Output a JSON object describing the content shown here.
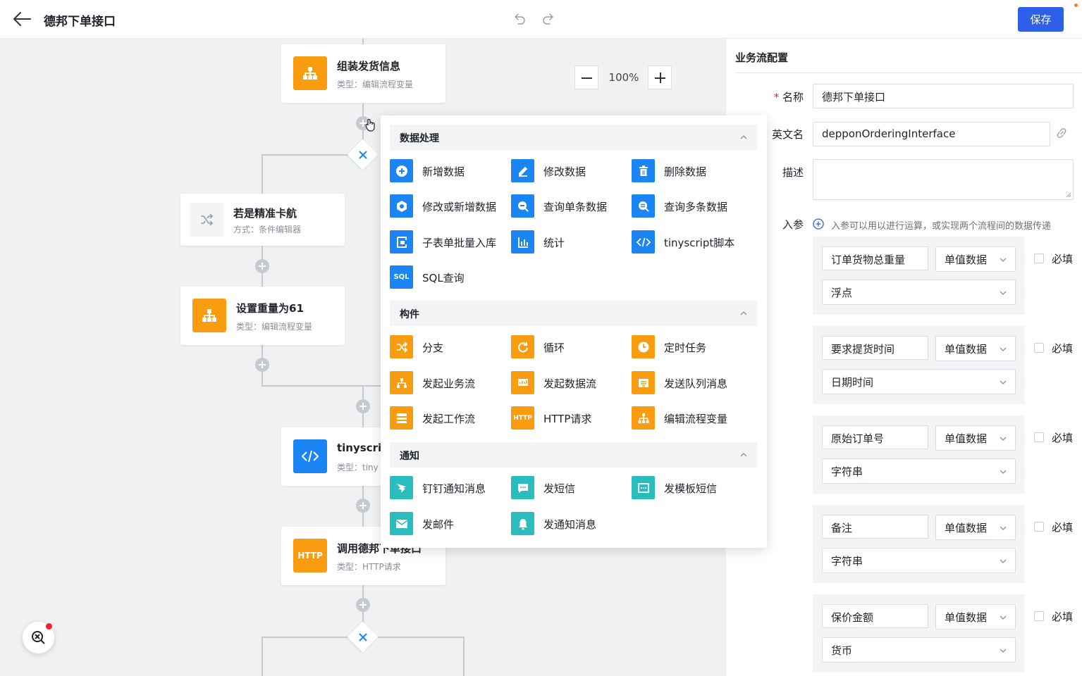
{
  "header": {
    "title": "德邦下单接口",
    "save_label": "保存"
  },
  "canvas": {
    "zoom": "100%",
    "nodes": [
      {
        "title": "组装发货信息",
        "subtitle": "类型：编辑流程变量"
      },
      {
        "title": "若是精准卡航",
        "subtitle": "方式：条件编辑器"
      },
      {
        "title": "设置重量为61",
        "subtitle": "类型：编辑流程变量"
      },
      {
        "title": "tinyscrip",
        "subtitle": "类型：tiny"
      },
      {
        "title": "调用德邦下单接口",
        "subtitle": "类型：HTTP请求"
      }
    ]
  },
  "popup": {
    "sections": [
      {
        "title": "数据处理",
        "items": [
          "新增数据",
          "修改数据",
          "删除数据",
          "修改或新增数据",
          "查询单条数据",
          "查询多条数据",
          "子表单批量入库",
          "统计",
          "tinyscript脚本",
          "SQL查询"
        ]
      },
      {
        "title": "构件",
        "items": [
          "分支",
          "循环",
          "定时任务",
          "发起业务流",
          "发起数据流",
          "发送队列消息",
          "发起工作流",
          "HTTP请求",
          "编辑流程变量"
        ]
      },
      {
        "title": "通知",
        "items": [
          "钉钉通知消息",
          "发短信",
          "发模板短信",
          "发邮件",
          "发通知消息"
        ]
      }
    ],
    "sql_icon_text": "SQL",
    "http_icon_text": "HTTP"
  },
  "panel": {
    "title": "业务流配置",
    "name_label": "名称",
    "name_required": "*",
    "name_value": "德邦下单接口",
    "en_label": "英文名",
    "en_value": "depponOrderingInterface",
    "desc_label": "描述",
    "params_label": "入参",
    "params_hint": "入参可以用以进行运算，或实现两个流程间的数据传递",
    "params": [
      {
        "name": "订单货物总重量",
        "kind": "单值数据",
        "type": "浮点",
        "required_label": "必填"
      },
      {
        "name": "要求提货时间",
        "kind": "单值数据",
        "type": "日期时间",
        "required_label": "必填"
      },
      {
        "name": "原始订单号",
        "kind": "单值数据",
        "type": "字符串",
        "required_label": "必填"
      },
      {
        "name": "备注",
        "kind": "单值数据",
        "type": "字符串",
        "required_label": "必填"
      },
      {
        "name": "保价金额",
        "kind": "单值数据",
        "type": "货币",
        "required_label": "必填"
      }
    ]
  },
  "colors": {
    "primary": "#2f5ee9",
    "orange": "#fa9c0f",
    "blue": "#1a85f3",
    "teal": "#2bbdbd"
  }
}
